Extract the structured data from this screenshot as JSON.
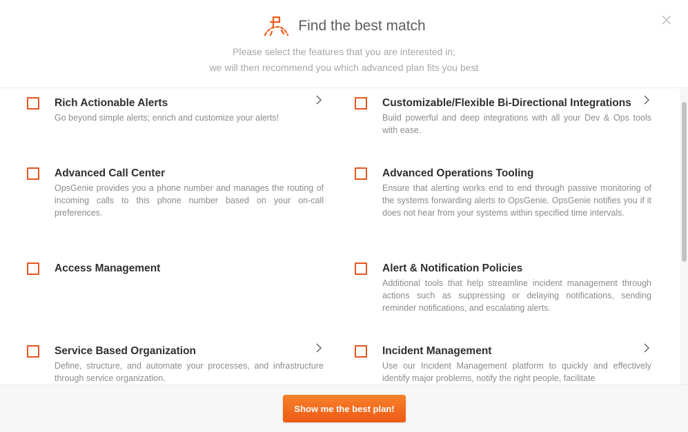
{
  "header": {
    "title": "Find the best match",
    "subtitle_line1": "Please select the features that you are interested in;",
    "subtitle_line2": "we will then recommend you which advanced plan fits you best",
    "icon": "flag-path-icon",
    "close_icon": "close-icon"
  },
  "features": [
    {
      "title": "Rich Actionable Alerts",
      "desc": "Go beyond simple alerts; enrich and customize your alerts!",
      "checked": false,
      "has_details": true
    },
    {
      "title": "Customizable/Flexible Bi-Directional Integrations",
      "desc": "Build powerful and deep integrations with all your Dev & Ops tools with ease.",
      "checked": false,
      "has_details": true
    },
    {
      "title": "Advanced Call Center",
      "desc": "OpsGenie provides you a phone number and manages the routing of incoming calls to this phone number based on your on-call preferences.",
      "checked": false,
      "has_details": false
    },
    {
      "title": "Advanced Operations Tooling",
      "desc": "Ensure that alerting works end to end through passive monitoring of the systems forwarding alerts to OpsGenie. OpsGenie notifies you if it does not hear from your systems within specified time intervals.",
      "checked": false,
      "has_details": false
    },
    {
      "title": "Access Management",
      "desc": "",
      "checked": false,
      "has_details": false
    },
    {
      "title": "Alert & Notification Policies",
      "desc": "Additional tools that help streamline incident management through actions such as suppressing or delaying notifications, sending reminder notifications, and escalating alerts.",
      "checked": false,
      "has_details": false
    },
    {
      "title": "Service Based Organization",
      "desc": "Define, structure, and automate your processes, and infrastructure through service organization.",
      "checked": false,
      "has_details": true
    },
    {
      "title": "Incident Management",
      "desc": "Use our Incident Management platform to quickly and effectively identify major problems, notify the right people, facilitate",
      "checked": false,
      "has_details": true
    }
  ],
  "footer": {
    "cta_label": "Show me the best plan!"
  },
  "colors": {
    "accent": "#e4551b",
    "button": "#f26b1d",
    "title_text": "#2f2f2f",
    "desc_text": "#8b8b8b"
  }
}
